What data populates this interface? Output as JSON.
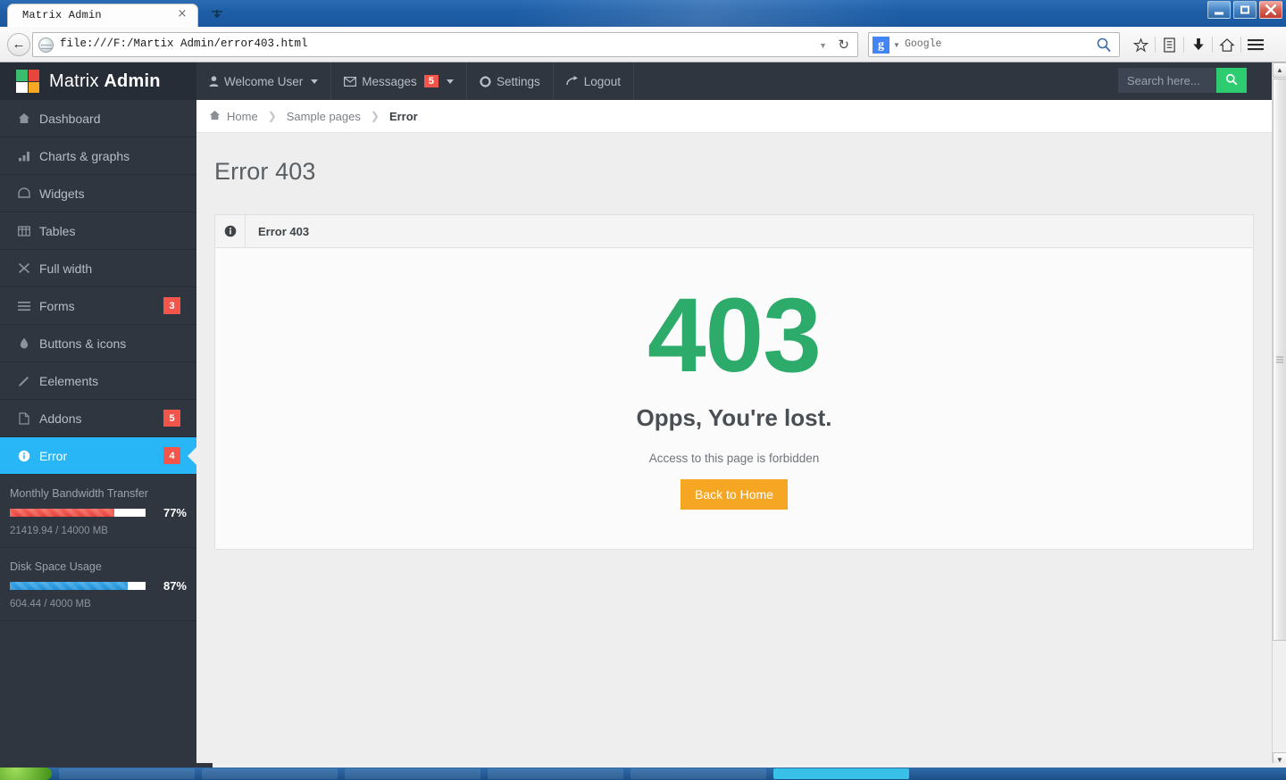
{
  "browser": {
    "tab_title": "Matrix Admin",
    "tab_close": "×",
    "url": "file:///F:/Martix Admin/error403.html",
    "search_engine": "Google",
    "search_engine_initial": "g",
    "back_arrow": "←",
    "reload": "↻",
    "dropdown_caret": "▼"
  },
  "sidebar": {
    "brand": {
      "name_light": "Matrix ",
      "name_bold": "Admin"
    },
    "logo_colors": [
      "#3bbd6f",
      "#e8453c",
      "#ffffff",
      "#f7a823"
    ],
    "items": [
      {
        "label": "Dashboard",
        "icon": "home-icon",
        "badge": ""
      },
      {
        "label": "Charts & graphs",
        "icon": "bar-chart-icon",
        "badge": ""
      },
      {
        "label": "Widgets",
        "icon": "widget-icon",
        "badge": ""
      },
      {
        "label": "Tables",
        "icon": "table-icon",
        "badge": ""
      },
      {
        "label": "Full width",
        "icon": "expand-icon",
        "badge": ""
      },
      {
        "label": "Forms",
        "icon": "list-icon",
        "badge": "3"
      },
      {
        "label": "Buttons & icons",
        "icon": "droplet-icon",
        "badge": ""
      },
      {
        "label": "Eelements",
        "icon": "pencil-icon",
        "badge": ""
      },
      {
        "label": "Addons",
        "icon": "file-icon",
        "badge": "5"
      },
      {
        "label": "Error",
        "icon": "info-circle-icon",
        "badge": "4",
        "active": true
      }
    ],
    "widgets": [
      {
        "title": "Monthly Bandwidth Transfer",
        "percent_label": "77%",
        "percent_value": 77,
        "detail": "21419.94 / 14000 MB",
        "color": "red"
      },
      {
        "title": "Disk Space Usage",
        "percent_label": "87%",
        "percent_value": 87,
        "detail": "604.44 / 4000 MB",
        "color": "blue"
      }
    ]
  },
  "topnav": {
    "items": [
      {
        "label": "Welcome User",
        "icon": "user-icon",
        "caret": true,
        "badge": ""
      },
      {
        "label": "Messages",
        "icon": "envelope-icon",
        "caret": true,
        "badge": "5"
      },
      {
        "label": "Settings",
        "icon": "gear-icon",
        "caret": false,
        "badge": ""
      },
      {
        "label": "Logout",
        "icon": "logout-icon",
        "caret": false,
        "badge": ""
      }
    ],
    "search_placeholder": "Search here...",
    "search_value": ""
  },
  "breadcrumb": {
    "home": "Home",
    "middle": "Sample pages",
    "current": "Error",
    "separator": "❯"
  },
  "page": {
    "title": "Error 403",
    "panel_title": "Error 403",
    "error_code": "403",
    "error_heading": "Opps, You're lost.",
    "error_subtext": "Access to this page is forbidden",
    "button_label": "Back to Home",
    "accent_green": "#2dab6a",
    "accent_orange": "#f5a623",
    "active_blue": "#29b6f6"
  }
}
